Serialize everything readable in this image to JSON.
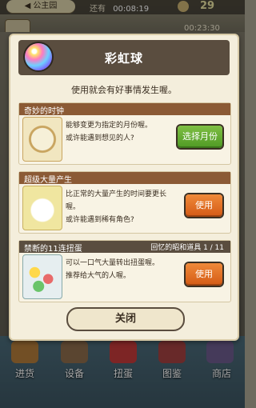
{
  "topbar": {
    "back_label": "◀ 公主园",
    "timer_prefix": "还有",
    "timer_value": "00:08:19",
    "coins": "29",
    "second_timer": "00:23:30"
  },
  "modal": {
    "title": "彩虹球",
    "subtitle": "使用就会有好事情发生喔。",
    "close_label": "关闭",
    "items": [
      {
        "name": "奇妙的时钟",
        "extra": "",
        "desc1": "能够变更为指定的月份喔。",
        "desc2": "或许能遇到想见的人?",
        "button": "选择月份"
      },
      {
        "name": "超级大量产生",
        "extra": "",
        "desc1": "比正常的大量产生的时间要更长喔。",
        "desc2": "或许能遇到稀有角色?",
        "button": "使用"
      },
      {
        "name": "禁断的11连扭蛋",
        "extra": "回忆的昭和道具 1 / 11",
        "desc1": "可以一口气大量转出扭蛋喔。",
        "desc2": "推荐给大气的人喔。",
        "button": "使用"
      }
    ]
  },
  "nav": {
    "items": [
      "进货",
      "设备",
      "扭蛋",
      "图鉴",
      "商店"
    ]
  }
}
